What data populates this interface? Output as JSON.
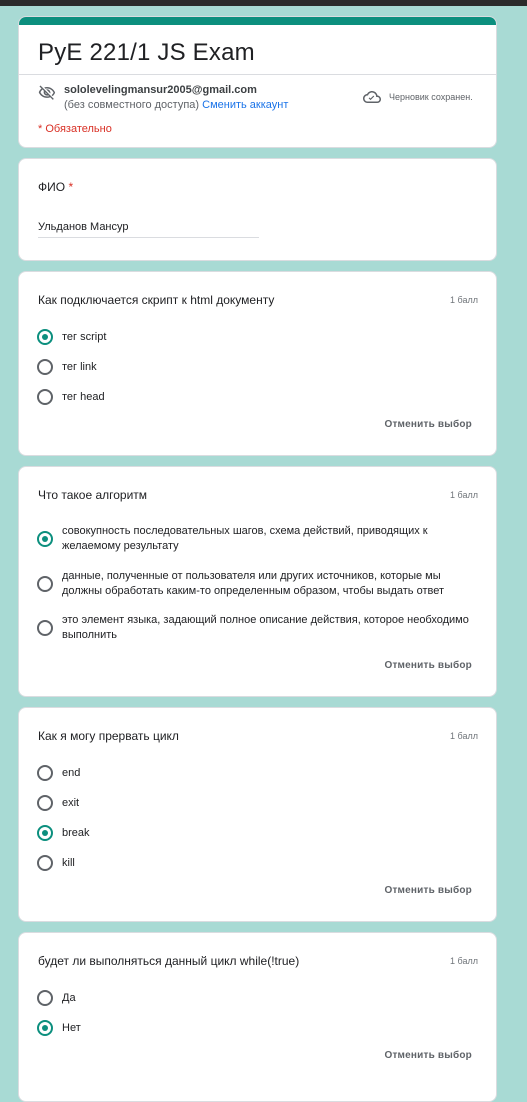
{
  "header": {
    "title": "PyE 221/1 JS Exam",
    "email": "sololevelingmansur2005@gmail.com",
    "sharing": "(без совместного доступа)",
    "switch_account": "Сменить аккаунт",
    "saved_status": "Черновик сохранен.",
    "required_note": "* Обязательно",
    "icons": {
      "privacy": "eye-off-icon",
      "cloud": "cloud-check-icon"
    }
  },
  "colors": {
    "accent": "#0c8f7e",
    "background": "#a8dad4",
    "required": "#d93025",
    "link": "#1a73e8"
  },
  "fio": {
    "label": "ФИО",
    "required_mark": "*",
    "value": "Ульданов Мансур"
  },
  "questions": [
    {
      "title": "Как подключается скрипт к html документу",
      "points": "1 балл",
      "options": [
        "тег script",
        "тег link",
        "тег head"
      ],
      "selected": 0,
      "clear_label": "Отменить выбор"
    },
    {
      "title": "Что такое алгоритм",
      "points": "1 балл",
      "options": [
        "совокупность последовательных шагов, схема действий, приводящих к желаемому результату",
        "данные, полученные от пользователя или других источников, которые мы должны обработать каким-то определенным образом, чтобы выдать ответ",
        "это элемент языка, задающий полное описание действия, которое необходимо выполнить"
      ],
      "selected": 0,
      "clear_label": "Отменить выбор"
    },
    {
      "title": "Как я могу прервать цикл",
      "points": "1 балл",
      "options": [
        "end",
        "exit",
        "break",
        "kill"
      ],
      "selected": 2,
      "clear_label": "Отменить выбор"
    },
    {
      "title": "будет ли выполняться данный цикл while(!true)",
      "points": "1 балл",
      "options": [
        "Да",
        "Нет"
      ],
      "selected": 1,
      "clear_label": "Отменить выбор"
    }
  ]
}
